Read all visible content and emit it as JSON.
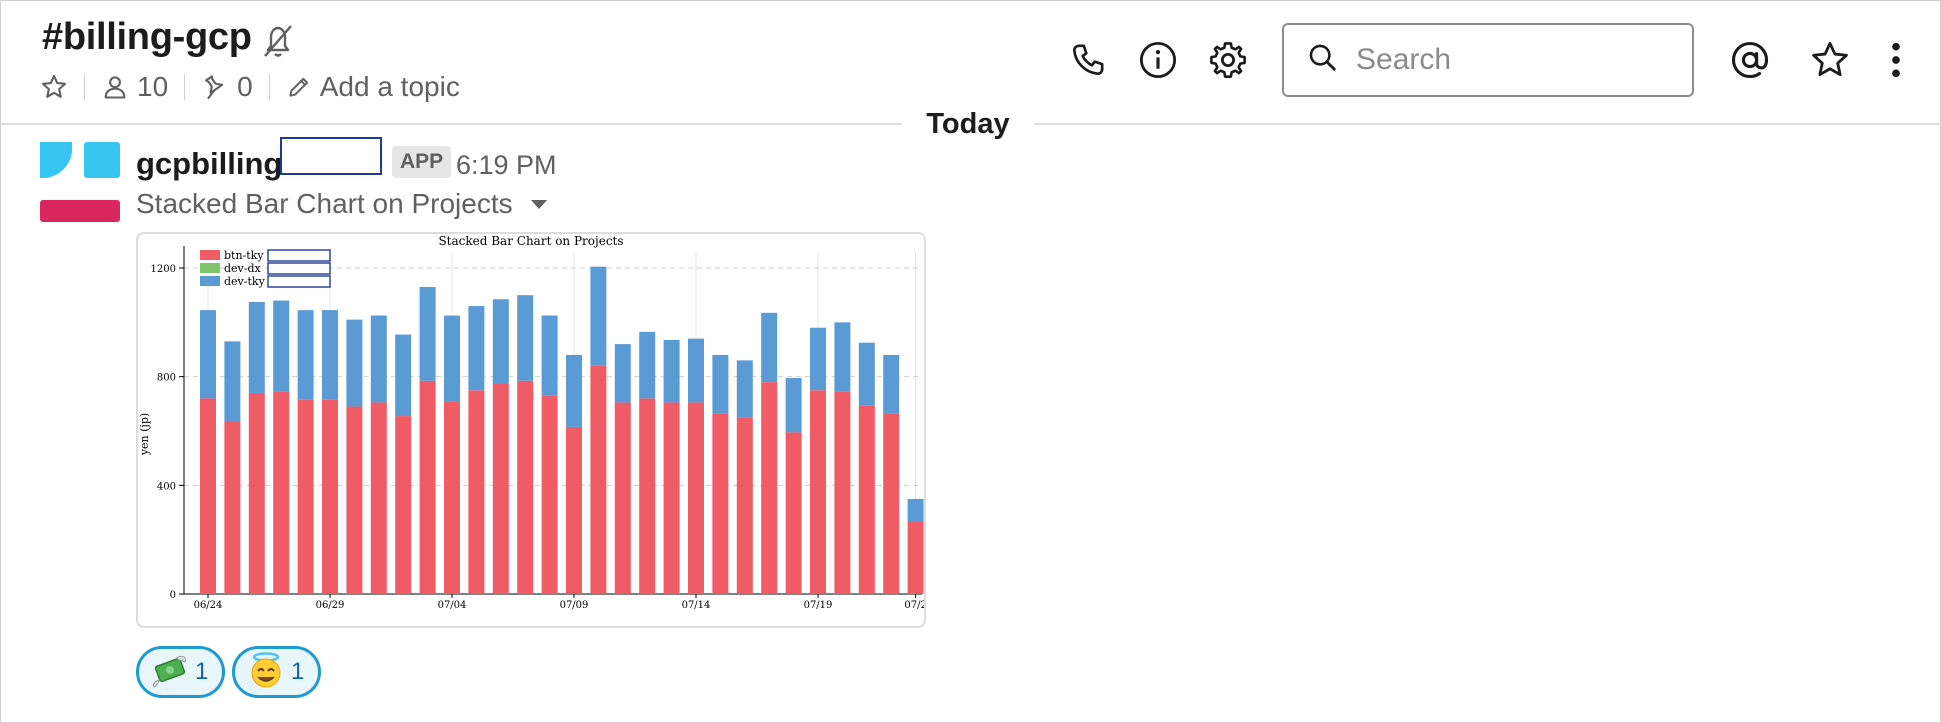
{
  "channel": {
    "name": "#billing-gcp",
    "members": "10",
    "pins": "0",
    "topic_link": "Add a topic"
  },
  "search": {
    "placeholder": "Search"
  },
  "divider": {
    "label": "Today"
  },
  "message": {
    "sender": "gcpbilling",
    "badge": "APP",
    "time": "6:19 PM",
    "attachment_title": "Stacked Bar Chart on Projects"
  },
  "reactions": [
    {
      "emoji": "money-with-wings",
      "count": "1"
    },
    {
      "emoji": "smiling-face-with-halo",
      "count": "1"
    }
  ],
  "colors": {
    "btn_tky": "#f05c66",
    "dev_dx": "#7ec46b",
    "dev_tky": "#5b9bd5",
    "reaction_border": "#1d9bd1",
    "logo_blue": "#36c5f0",
    "logo_red": "#e01e5a"
  },
  "icons": [
    "star-icon",
    "member-icon",
    "pin-icon",
    "pencil-icon",
    "mute-icon",
    "phone-icon",
    "info-icon",
    "gear-icon",
    "search-icon",
    "at-icon",
    "star-icon",
    "more-icon",
    "caret-down-icon"
  ],
  "chart_data": {
    "type": "bar",
    "stacked": true,
    "title": "Stacked Bar Chart on Projects",
    "ylabel": "yen (jp)",
    "xlabel": "",
    "ylim": [
      0,
      1200
    ],
    "yticks": [
      0,
      400,
      800,
      1200
    ],
    "grid": true,
    "legend_position": "top-left",
    "xtick_labels": [
      "06/24",
      "06/29",
      "07/04",
      "07/09",
      "07/14",
      "07/19",
      "07/2"
    ],
    "categories": [
      "06/24",
      "06/25",
      "06/26",
      "06/27",
      "06/28",
      "06/29",
      "06/30",
      "07/01",
      "07/02",
      "07/03",
      "07/04",
      "07/05",
      "07/06",
      "07/07",
      "07/08",
      "07/09",
      "07/10",
      "07/11",
      "07/12",
      "07/13",
      "07/14",
      "07/15",
      "07/16",
      "07/17",
      "07/18",
      "07/19",
      "07/20",
      "07/21",
      "07/22",
      "07/23"
    ],
    "series": [
      {
        "name": "btn-tky",
        "values": [
          720,
          635,
          740,
          745,
          715,
          715,
          690,
          705,
          655,
          785,
          710,
          750,
          775,
          785,
          730,
          615,
          840,
          705,
          720,
          705,
          705,
          665,
          650,
          780,
          595,
          750,
          745,
          695,
          665,
          265
        ]
      },
      {
        "name": "dev-dx",
        "values": [
          0,
          0,
          0,
          0,
          0,
          0,
          0,
          0,
          0,
          0,
          0,
          0,
          0,
          0,
          0,
          0,
          0,
          0,
          0,
          0,
          0,
          0,
          0,
          0,
          0,
          0,
          0,
          0,
          0,
          0
        ]
      },
      {
        "name": "dev-tky",
        "values": [
          325,
          295,
          335,
          335,
          330,
          330,
          320,
          320,
          300,
          345,
          315,
          310,
          310,
          315,
          295,
          265,
          365,
          215,
          245,
          230,
          235,
          215,
          210,
          255,
          200,
          230,
          255,
          230,
          215,
          85
        ]
      }
    ]
  }
}
